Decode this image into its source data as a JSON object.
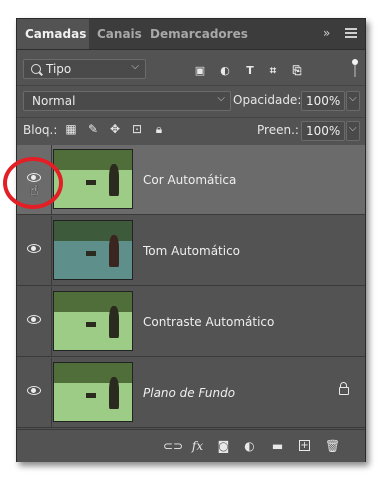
{
  "tabs": [
    {
      "label": "Camadas",
      "active": true
    },
    {
      "label": "Canais",
      "active": false
    },
    {
      "label": "Demarcadores",
      "active": false
    }
  ],
  "panel_menu": {
    "collapse_glyph": "»"
  },
  "filter": {
    "label": "Tipo",
    "icons": [
      "image-filter-icon",
      "adjustment-filter-icon",
      "type-filter-icon",
      "shape-filter-icon",
      "smart-object-filter-icon"
    ]
  },
  "blend": {
    "mode": "Normal",
    "opacity_label": "Opacidade:",
    "opacity_value": "100%"
  },
  "lock": {
    "label": "Bloq.:",
    "fill_label": "Preen.:",
    "fill_value": "100%"
  },
  "layers": [
    {
      "name": "Cor Automática",
      "selected": true,
      "italic": false,
      "locked": false,
      "thumb": "green"
    },
    {
      "name": "Tom Automático",
      "selected": false,
      "italic": false,
      "locked": false,
      "thumb": "blue"
    },
    {
      "name": "Contraste Automático",
      "selected": false,
      "italic": false,
      "locked": false,
      "thumb": "green"
    },
    {
      "name": "Plano de Fundo",
      "selected": false,
      "italic": true,
      "locked": true,
      "thumb": "green"
    }
  ],
  "bottom_glyphs": {
    "fx": "fx",
    "folder": "▬",
    "add": "+"
  },
  "colors": {
    "panel": "#535353",
    "selected": "#6b6b6b",
    "annotation": "#e31e24"
  }
}
